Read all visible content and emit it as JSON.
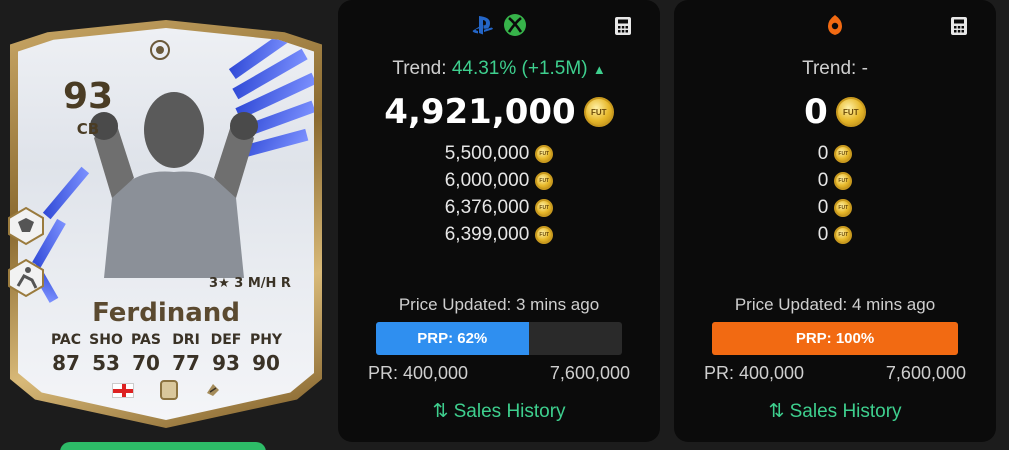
{
  "card": {
    "rating": "93",
    "position": "CB",
    "name": "Ferdinand",
    "playstyle": "3★ 3 M/H R",
    "stats": [
      {
        "label": "PAC",
        "value": "87"
      },
      {
        "label": "SHO",
        "value": "53"
      },
      {
        "label": "PAS",
        "value": "70"
      },
      {
        "label": "DRI",
        "value": "77"
      },
      {
        "label": "DEF",
        "value": "93"
      },
      {
        "label": "PHY",
        "value": "90"
      }
    ],
    "nation_icon": "england-flag-icon",
    "league_icon": "icons-league-icon",
    "club_icon": "club-badge-icon",
    "accent_color": "#2f49d6",
    "frame_color": "#c9a766"
  },
  "console": {
    "platform_icons": [
      "playstation-icon",
      "xbox-icon"
    ],
    "trend_label": "Trend:",
    "trend_value": "44.31% (+1.5M)",
    "trend_arrow": "▲",
    "price": "4,921,000",
    "coin_label": "FUT",
    "prices": [
      "5,500,000",
      "6,000,000",
      "6,376,000",
      "6,399,000"
    ],
    "updated": "Price Updated: 3 mins ago",
    "prp_label": "PRP: 62%",
    "prp_fraction": 0.62,
    "prp_color": "#2f8ff0",
    "range_min": "PR: 400,000",
    "range_max": "7,600,000",
    "sales_label": "⇅ Sales History"
  },
  "pc": {
    "platform_icons": [
      "origin-icon"
    ],
    "trend_label": "Trend:",
    "trend_value": "-",
    "price": "0",
    "coin_label": "FUT",
    "prices": [
      "0",
      "0",
      "0",
      "0"
    ],
    "updated": "Price Updated: 4 mins ago",
    "prp_label": "PRP: 100%",
    "prp_fraction": 1.0,
    "prp_color": "#f26a12",
    "range_min": "PR: 400,000",
    "range_max": "7,600,000",
    "sales_label": "⇅ Sales History"
  }
}
